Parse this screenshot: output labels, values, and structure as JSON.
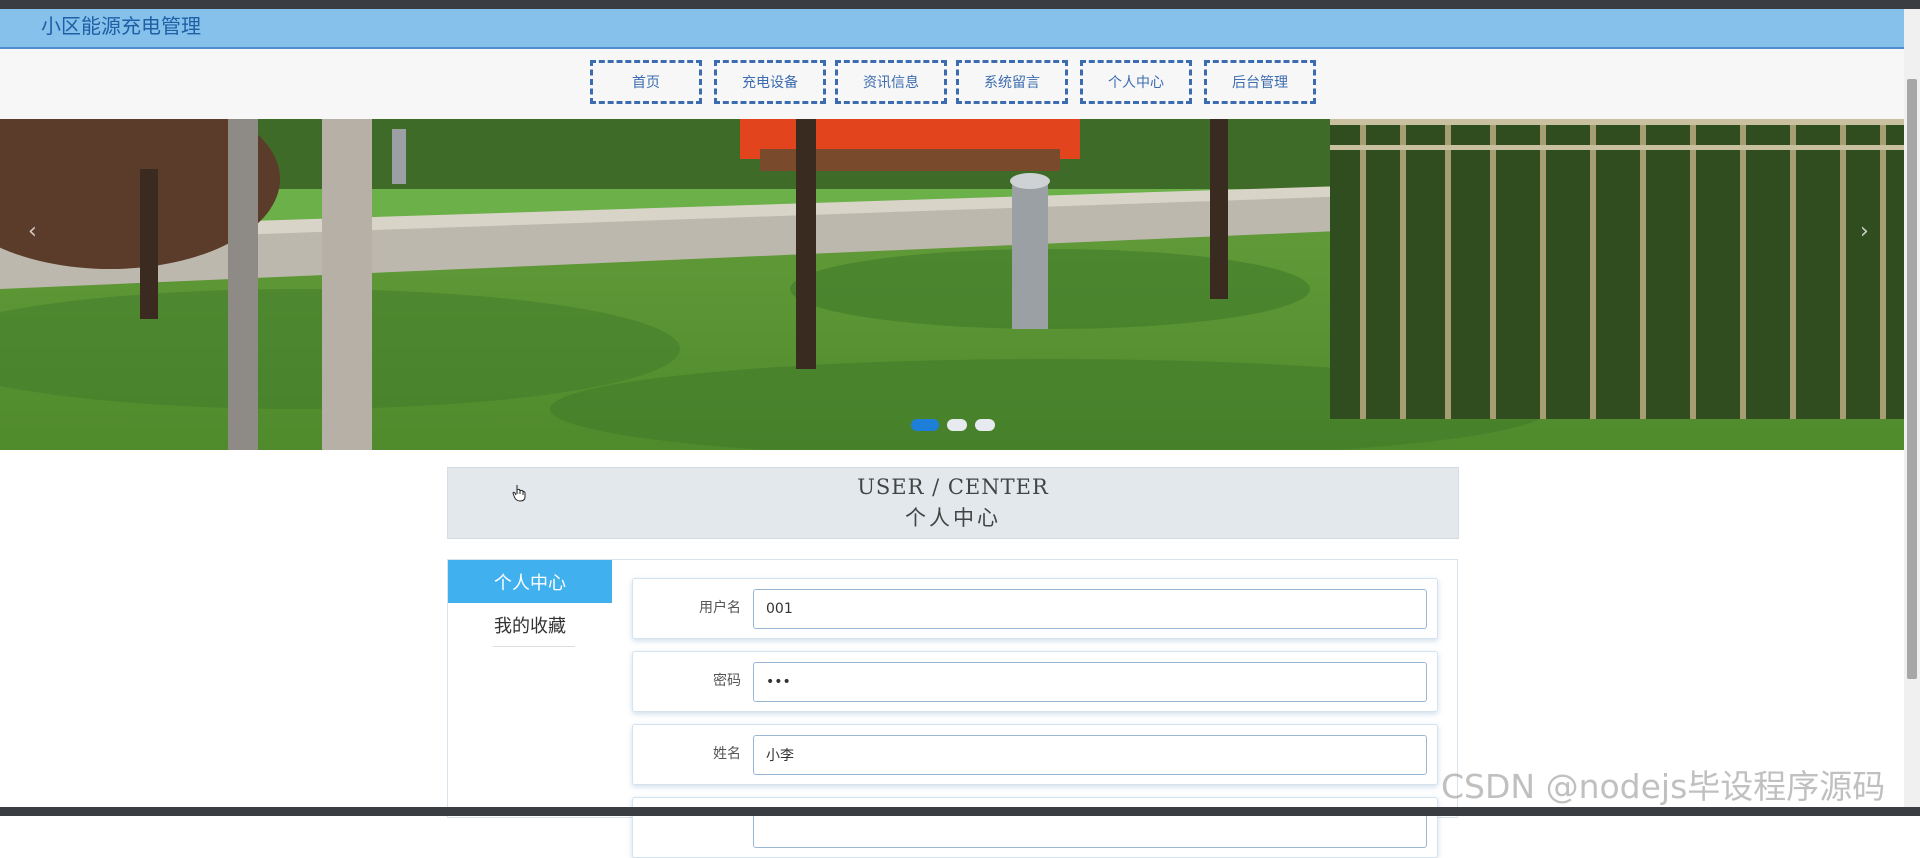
{
  "site": {
    "title": "小区能源充电管理"
  },
  "nav": {
    "items": [
      {
        "label": "首页"
      },
      {
        "label": "充电设备"
      },
      {
        "label": "资讯信息"
      },
      {
        "label": "系统留言"
      },
      {
        "label": "个人中心"
      },
      {
        "label": "后台管理"
      }
    ]
  },
  "banner": {
    "prev_icon": "chevron-left-icon",
    "next_icon": "chevron-right-icon",
    "prev_glyph": "‹",
    "next_glyph": "›",
    "slide_count": 3,
    "active_slide": 1
  },
  "section": {
    "en_title": "USER / CENTER",
    "cn_title": "个人中心"
  },
  "sidebar": {
    "items": [
      {
        "label": "个人中心",
        "active": true
      },
      {
        "label": "我的收藏",
        "active": false
      }
    ]
  },
  "form": {
    "fields": [
      {
        "label": "用户名",
        "value": "001",
        "type": "text"
      },
      {
        "label": "密码",
        "value": "123",
        "type": "password"
      },
      {
        "label": "姓名",
        "value": "小李",
        "type": "text"
      },
      {
        "label": "",
        "value": "",
        "type": "text"
      }
    ]
  },
  "watermark": {
    "text": "CSDN @nodejs毕设程序源码"
  },
  "colors": {
    "title_bar": "#85c1ea",
    "nav_border": "#3c6cb0",
    "sidebar_active": "#40b0ef",
    "dot_active": "#1e7fd9"
  }
}
